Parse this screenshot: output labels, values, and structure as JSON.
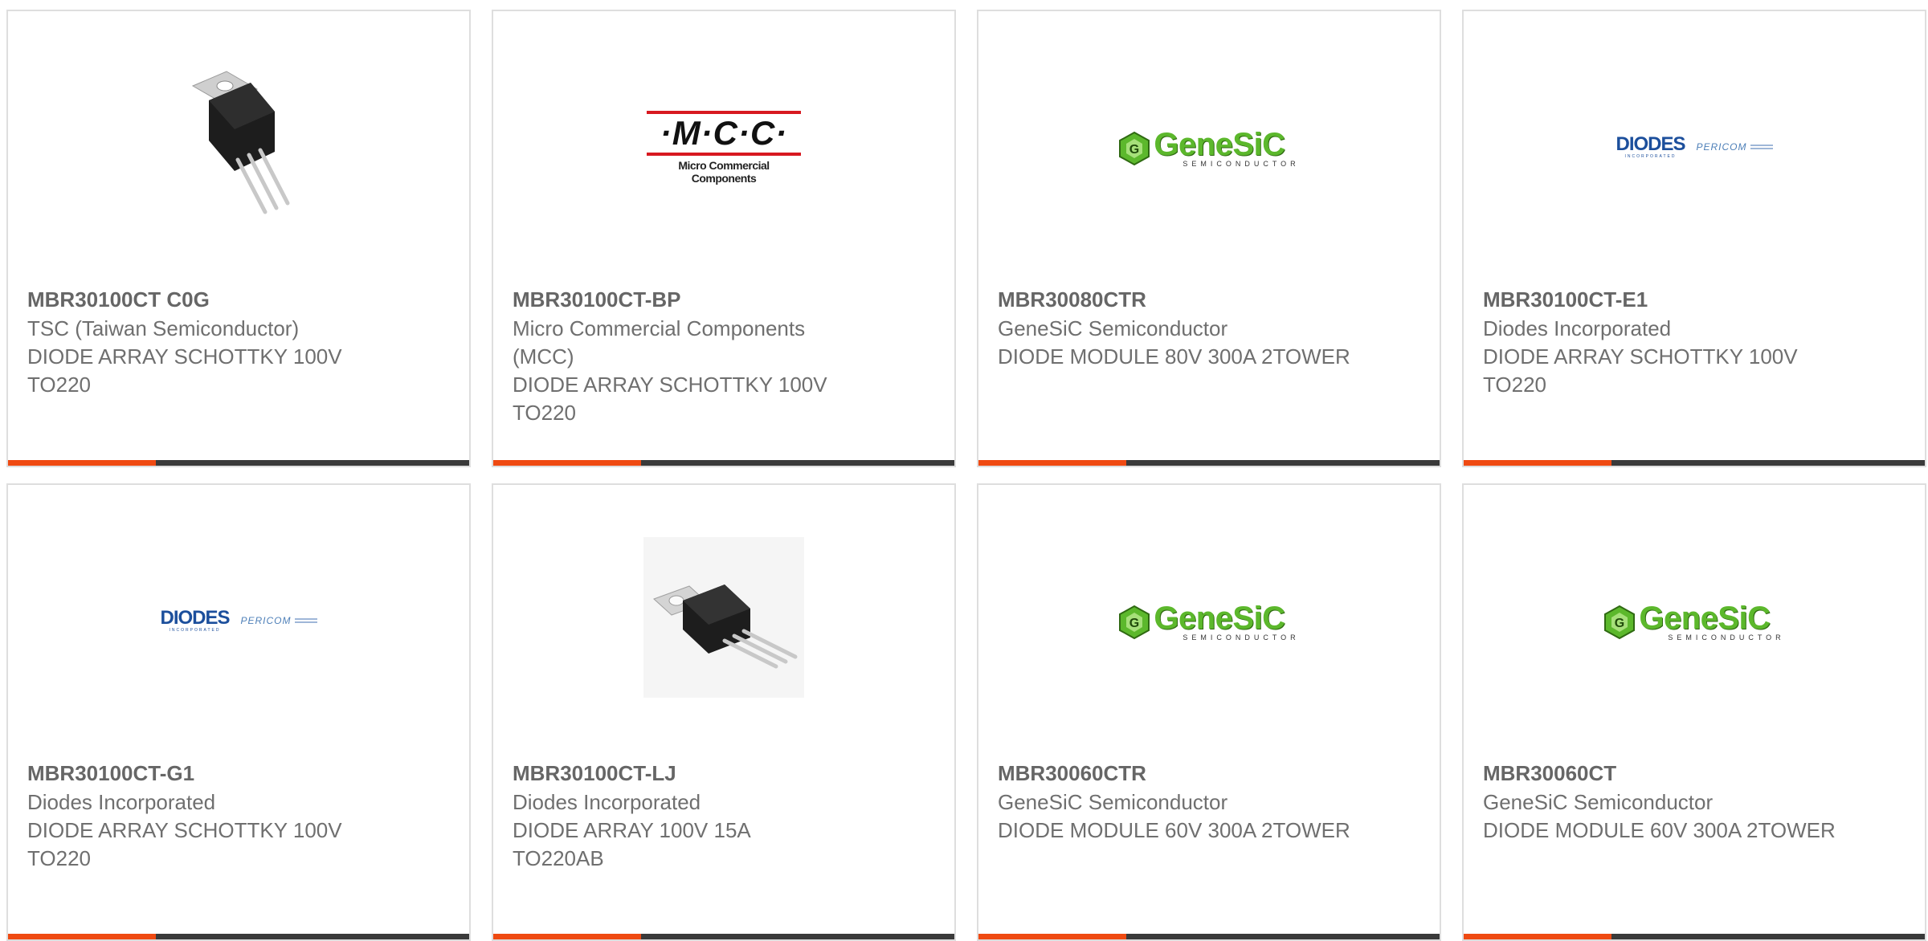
{
  "products": [
    {
      "part_number": "MBR30100CT C0G",
      "manufacturer": "TSC (Taiwan Semiconductor)",
      "description": "DIODE ARRAY SCHOTTKY 100V TO220",
      "image": "to220-photo"
    },
    {
      "part_number": "MBR30100CT-BP",
      "manufacturer": "Micro Commercial Components (MCC)",
      "description": "DIODE ARRAY SCHOTTKY 100V TO220",
      "image": "mcc-logo",
      "logo": {
        "text": "·M·C·C·",
        "tagline": "Micro Commercial Components"
      }
    },
    {
      "part_number": "MBR30080CTR",
      "manufacturer": "GeneSiC Semiconductor",
      "description": "DIODE MODULE 80V 300A 2TOWER",
      "image": "genesic-logo",
      "logo": {
        "text": "GeneSiC",
        "tagline": "SEMICONDUCTOR"
      }
    },
    {
      "part_number": "MBR30100CT-E1",
      "manufacturer": "Diodes Incorporated",
      "description": "DIODE ARRAY SCHOTTKY 100V TO220",
      "image": "diodes-logo",
      "logo": {
        "text": "DIODES",
        "tagline": "INCORPORATED",
        "partner": "PERICOM"
      }
    },
    {
      "part_number": "MBR30100CT-G1",
      "manufacturer": "Diodes Incorporated",
      "description": "DIODE ARRAY SCHOTTKY 100V TO220",
      "image": "diodes-logo",
      "logo": {
        "text": "DIODES",
        "tagline": "INCORPORATED",
        "partner": "PERICOM"
      }
    },
    {
      "part_number": "MBR30100CT-LJ",
      "manufacturer": "Diodes Incorporated",
      "description": "DIODE ARRAY 100V 15A TO220AB",
      "image": "to220-photo"
    },
    {
      "part_number": "MBR30060CTR",
      "manufacturer": "GeneSiC Semiconductor",
      "description": "DIODE MODULE 60V 300A 2TOWER",
      "image": "genesic-logo",
      "logo": {
        "text": "GeneSiC",
        "tagline": "SEMICONDUCTOR"
      }
    },
    {
      "part_number": "MBR30060CT",
      "manufacturer": "GeneSiC Semiconductor",
      "description": "DIODE MODULE 60V 300A 2TOWER",
      "image": "genesic-logo",
      "logo": {
        "text": "GeneSiC",
        "tagline": "SEMICONDUCTOR"
      }
    }
  ],
  "colors": {
    "accent": "#ef4a12",
    "bar": "#3a3a3a",
    "text": "#6f6f6f",
    "border": "#dedede"
  }
}
